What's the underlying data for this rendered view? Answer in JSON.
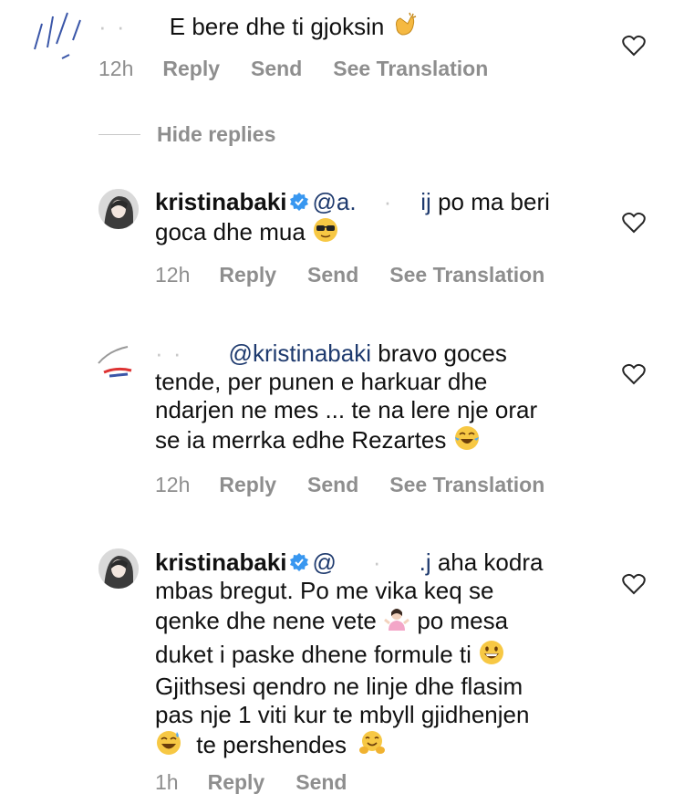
{
  "comments": [
    {
      "username_hidden": "·  ·",
      "text": "E bere dhe ti gjoksin",
      "emoji": "clapping-hands",
      "time": "12h",
      "reply": "Reply",
      "send": "Send",
      "translate": "See Translation"
    },
    {
      "username": "kristinabaki",
      "mention": "@a.",
      "mention_tail": "ij",
      "text": "po ma beri",
      "text2": "goca dhe mua",
      "emoji": "sunglasses-face",
      "time": "12h",
      "reply": "Reply",
      "send": "Send",
      "translate": "See Translation"
    },
    {
      "username_hidden": "·  ·",
      "mention": "@kristinabaki",
      "text_line1": "bravo goces",
      "text_line2": "tende, per punen e harkuar dhe",
      "text_line3": "ndarjen ne mes ... te na lere nje orar",
      "text_line4": "se ia merrka edhe Rezartes",
      "emoji": "tears-of-joy",
      "time": "12h",
      "reply": "Reply",
      "send": "Send",
      "translate": "See Translation"
    },
    {
      "username": "kristinabaki",
      "mention": "@",
      "mention_tail": ".j",
      "line1": "aha kodra",
      "line2": "mbas bregut. Po me vika keq se",
      "line3a": "qenke dhe nene vete",
      "line3b": "po mesa",
      "line4": "duket i paske dhene formule ti",
      "line5": "Gjithsesi  qendro ne linje dhe flasim",
      "line6": "pas nje 1 viti kur te mbyll gjidhenjen",
      "line7": "te pershendes",
      "time": "1h",
      "reply": "Reply",
      "send": "Send"
    }
  ],
  "hide_replies": "Hide replies",
  "colors": {
    "meta": "#8e8e8e",
    "mention": "#1e3a6e",
    "verified": "#3897f0"
  }
}
